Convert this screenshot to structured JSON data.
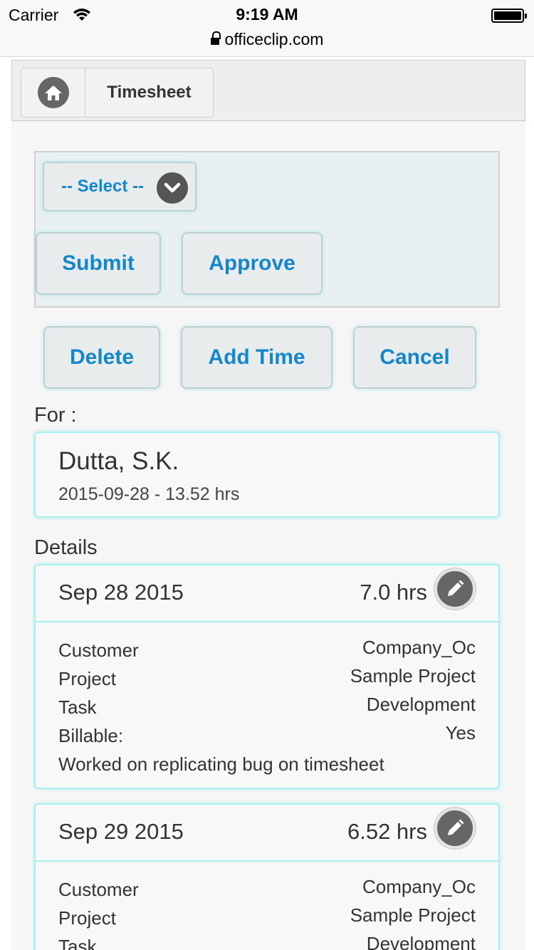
{
  "status_bar": {
    "carrier": "Carrier",
    "time": "9:19 AM",
    "url": "officeclip.com"
  },
  "nav": {
    "title": "Timesheet",
    "home_icon": "home-icon"
  },
  "actions": {
    "select_label": "-- Select --",
    "submit_label": "Submit",
    "approve_label": "Approve",
    "delete_label": "Delete",
    "add_time_label": "Add Time",
    "cancel_label": "Cancel"
  },
  "for_section": {
    "label": "For :",
    "name": "Dutta, S.K.",
    "summary": "2015-09-28 - 13.52 hrs"
  },
  "details": {
    "label": "Details",
    "entries": [
      {
        "date": "Sep 28 2015",
        "hours": "7.0 hrs",
        "customer_key": "Customer",
        "customer": "Company_Oc",
        "project_key": "Project",
        "project": "Sample Project",
        "task_key": "Task",
        "task": "Development",
        "billable_key": "Billable:",
        "billable": "Yes",
        "note": "Worked on replicating bug on timesheet"
      },
      {
        "date": "Sep 29 2015",
        "hours": "6.52 hrs",
        "customer_key": "Customer",
        "customer": "Company_Oc",
        "project_key": "Project",
        "project": "Sample Project",
        "task_key": "Task",
        "task": "Development"
      }
    ]
  },
  "colors": {
    "accent_text": "#1586c9",
    "card_border": "#a6f0ef",
    "panel_bg": "#e9f0f2"
  }
}
